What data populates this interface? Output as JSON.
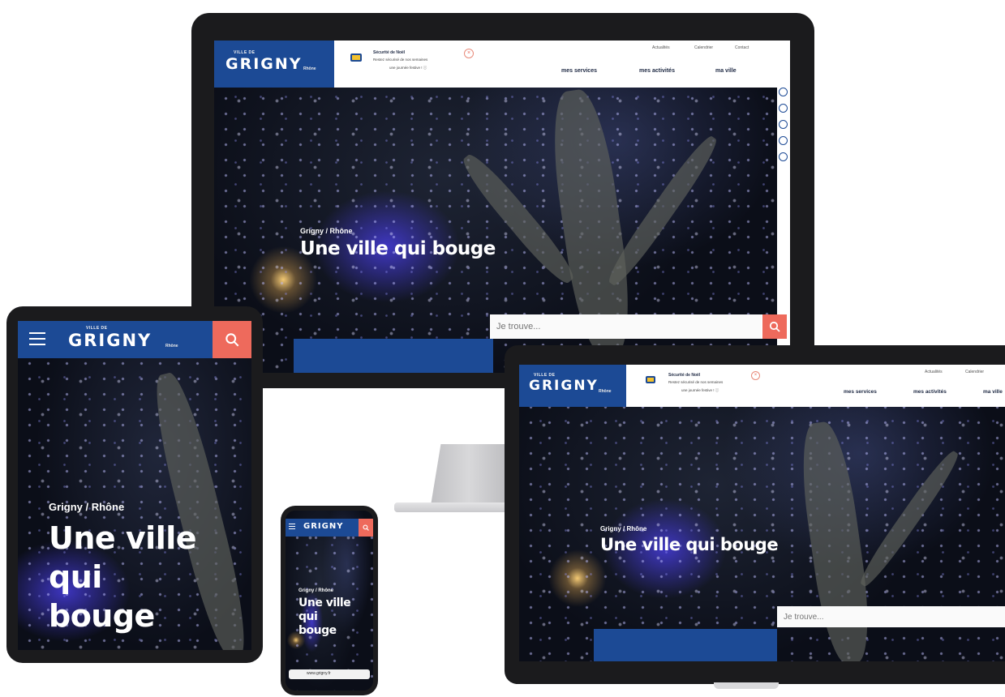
{
  "brand": {
    "pre": "VILLE DE",
    "name": "GRIGNY",
    "suffix": "Rhône"
  },
  "notice": {
    "title": "Sécurité de Noël",
    "line1": "Restez sécurisé de nos semaines",
    "line2": "une journée festive ! ⓘ"
  },
  "utility_nav": [
    "Actualités",
    "Calendrier",
    "Contact"
  ],
  "main_nav": [
    "mes services",
    "mes activités",
    "ma ville"
  ],
  "hero": {
    "kicker": "Grigny / Rhône",
    "title": "Une ville qui bouge",
    "title_tablet_lines": [
      "Une ville",
      "qui",
      "bouge"
    ]
  },
  "search": {
    "placeholder": "Je trouve..."
  },
  "phone_bottom": {
    "label": "www.grigny.fr"
  },
  "colors": {
    "brand_blue": "#1c4a95",
    "accent_coral": "#ee6a5c",
    "accent_yellow": "#f2c12e"
  },
  "icons": [
    "search-icon",
    "menu-icon",
    "close-icon",
    "facebook-icon",
    "twitter-icon",
    "instagram-icon",
    "youtube-icon",
    "mail-icon"
  ]
}
